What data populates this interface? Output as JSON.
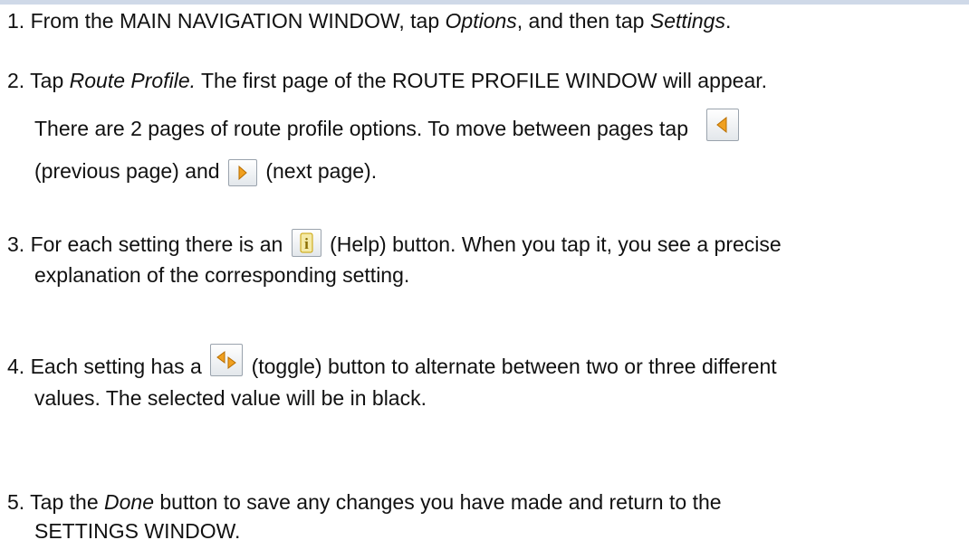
{
  "steps": [
    {
      "number": "1.",
      "t1": "From the MAIN NAVIGATION WINDOW, tap ",
      "em1": "Options",
      "t2": ", and then tap ",
      "em2": "Settings",
      "t3": "."
    },
    {
      "number": "2.",
      "t1": "Tap ",
      "em1": "Route Profile.",
      "t2": "  The first page of the ROUTE PROFILE WINDOW will appear.",
      "sub1": "There are 2 pages of route profile options.  To move between pages tap",
      "sub2a": "(previous page) and",
      "sub2b": "(next page)."
    },
    {
      "number": "3.",
      "l1a": "For each setting there is an",
      "l1b": "(Help) button.  When you tap it, you see a precise",
      "l2": "explanation of the corresponding setting."
    },
    {
      "number": "4.",
      "l1a": "Each setting has a",
      "l1b": "(toggle) button to alternate between two or three different",
      "l2": "values.  The selected value will be in black."
    },
    {
      "number": "5.",
      "t1": "Tap the ",
      "em1": "Done",
      "t2": " button to save any changes you have made and return to the",
      "l2": "SETTINGS WINDOW."
    }
  ],
  "icons": {
    "previous_page": "previous-page-icon",
    "next_page": "next-page-icon",
    "help": "help-icon",
    "toggle": "toggle-icon"
  },
  "colors": {
    "arrow": "#f0a020",
    "help_glyph": "#c8a000",
    "top_rule": "#cfd9e8"
  }
}
